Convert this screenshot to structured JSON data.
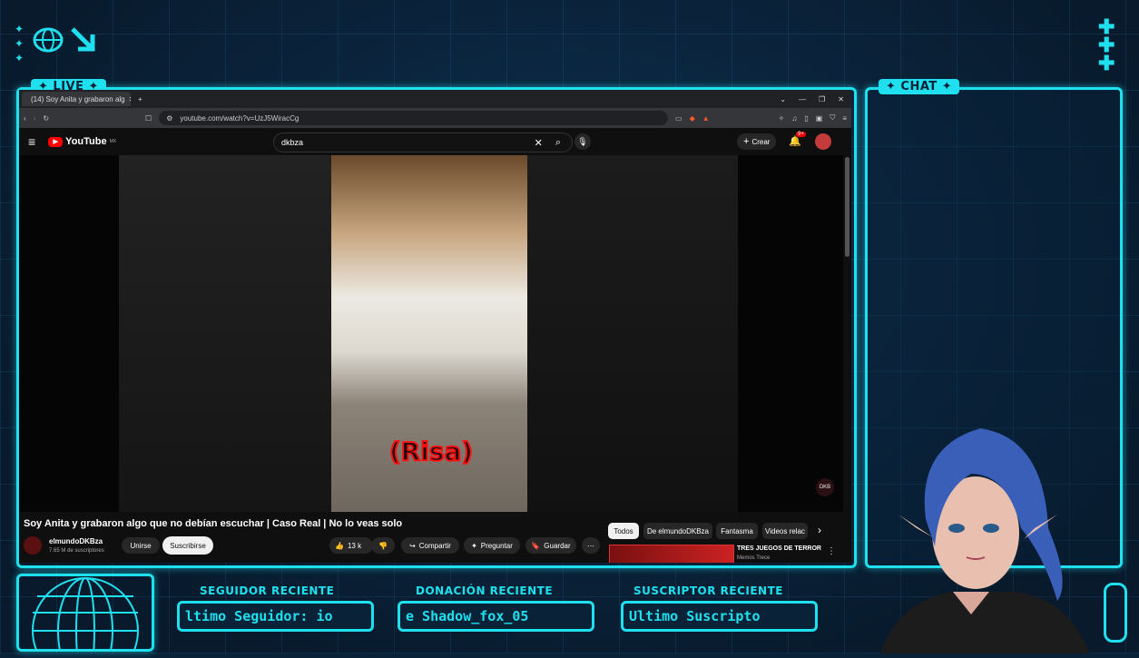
{
  "overlay": {
    "live_tag": "✦ LIVE ✦",
    "chat_tag": "✦ CHAT ✦",
    "follower_label": "SEGUIDOR RECIENTE",
    "follower_value": "ltimo Seguidor: io",
    "donation_label": "DONACIÓN RECIENTE",
    "donation_value": "e Shadow_fox_05",
    "subscriber_label": "SUSCRIPTOR RECIENTE",
    "subscriber_value": "Ultimo Suscripto"
  },
  "browser": {
    "tab_title": "(14) Soy Anita y grabaron alg",
    "url": "youtube.com/watch?v=UzJ5WiracCg"
  },
  "youtube": {
    "logo": "YouTube",
    "region": "MX",
    "search_query": "dkbza",
    "create_label": "Crear",
    "notif_count": "9+",
    "caption": "(Risa)",
    "video_title": "Soy Anita y grabaron algo que no debían escuchar | Caso Real | No lo veas solo",
    "channel_name": "elmundoDKBza",
    "subscribers": "7.65 M de suscriptores",
    "join_label": "Unirse",
    "subscribe_label": "Suscribirse",
    "like_count": "13 k",
    "share_label": "Compartir",
    "ask_label": "Preguntar",
    "save_label": "Guardar",
    "chips": [
      "Todos",
      "De elmundoDKBza",
      "Fantasma",
      "Videos relac"
    ],
    "rec_title": "TRES JUEGOS DE TERROR",
    "rec_channel": "Memos Trece",
    "watermark": "DKB"
  },
  "colors": {
    "accent": "#1fe0ee",
    "background": "#0a2238",
    "yt_red": "#ff0000"
  }
}
